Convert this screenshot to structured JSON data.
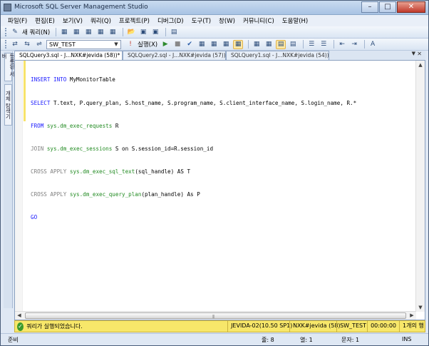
{
  "window": {
    "title": "Microsoft SQL Server Management Studio"
  },
  "menu": [
    "파일(F)",
    "편집(E)",
    "보기(V)",
    "쿼리(Q)",
    "프로젝트(P)",
    "디버그(D)",
    "도구(T)",
    "창(W)",
    "커뮤니티(C)",
    "도움말(H)"
  ],
  "toolbar": {
    "new_query": "새 쿼리(N)",
    "database": "SW_TEST",
    "execute": "실행(X)"
  },
  "side_tabs": [
    "등록된 서버",
    "개체 탐색기"
  ],
  "tabs": [
    {
      "label": "SQLQuery3.sql - J...NXK#jevida (58))*",
      "active": true
    },
    {
      "label": "SQLQuery2.sql - J...NXK#jevida (57))*",
      "active": false
    },
    {
      "label": "SQLQuery1.sql - J...NXK#jevida (54))*",
      "active": false
    }
  ],
  "code_lines": [
    "INSERT INTO MyMonitorTable",
    "SELECT T.text, P.query_plan, S.host_name, S.program_name, S.client_interface_name, S.login_name, R.*",
    "FROM sys.dm_exec_requests R",
    "JOIN sys.dm_exec_sessions S on S.session_id=R.session_id",
    "CROSS APPLY sys.dm_exec_sql_text(sql_handle) AS T",
    "CROSS APPLY sys.dm_exec_query_plan(plan_handle) As P",
    "GO"
  ],
  "query_status": {
    "message": "쿼리가 실행되었습니다.",
    "server": "JEVIDA-02(10.50 SP1)",
    "user": "NXK#jevida (58)",
    "database": "SW_TEST",
    "elapsed": "00:00:00",
    "rows": "1개의 행"
  },
  "statusbar": {
    "ready": "준비",
    "line": "줄: 8",
    "column": "열: 1",
    "char": "문자: 1",
    "mode": "INS"
  }
}
